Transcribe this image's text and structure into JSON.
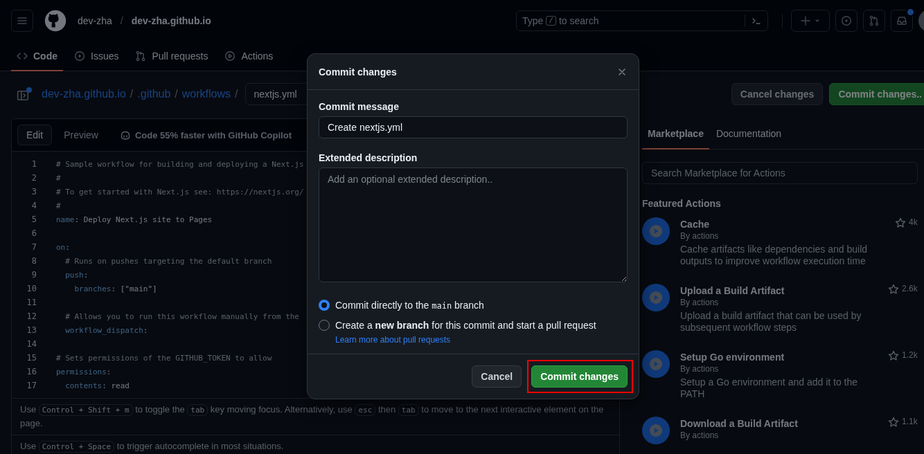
{
  "header": {
    "owner": "dev-zha",
    "separator": "/",
    "repo": "dev-zha.github.io",
    "search": {
      "before": "Type",
      "key": "/",
      "after": "to search"
    },
    "inbox_unread": true
  },
  "repo_tabs": [
    {
      "label": "Code",
      "selected": true
    },
    {
      "label": "Issues",
      "selected": false
    },
    {
      "label": "Pull requests",
      "selected": false
    },
    {
      "label": "Actions",
      "selected": false
    }
  ],
  "breadcrumb": {
    "path": [
      {
        "kind": "link",
        "text": "dev-zha.github.io"
      },
      {
        "kind": "separator",
        "text": "/"
      },
      {
        "kind": "link",
        "text": ".github"
      },
      {
        "kind": "separator",
        "text": "/"
      },
      {
        "kind": "link",
        "text": "workflows"
      },
      {
        "kind": "separator",
        "text": "/"
      }
    ],
    "filename": "nextjs.yml",
    "buttons": [
      {
        "label": "Cancel changes",
        "kind": "secondary"
      },
      {
        "label": "Commit changes..",
        "kind": "primary"
      }
    ]
  },
  "editor": {
    "tabs": [
      {
        "label": "Edit",
        "selected": true
      },
      {
        "label": "Preview",
        "selected": false
      }
    ],
    "copilot_hint": "Code 55% faster with GitHub Copilot",
    "lines": [
      {
        "number": "1",
        "tokens": [
          {
            "kind": "comment",
            "text": "# Sample workflow for building and deploying a Next.js"
          }
        ]
      },
      {
        "number": "2",
        "tokens": [
          {
            "kind": "comment",
            "text": "#"
          }
        ]
      },
      {
        "number": "3",
        "tokens": [
          {
            "kind": "comment",
            "text": "# To get started with Next.js see: https://nextjs.org/"
          }
        ]
      },
      {
        "number": "4",
        "tokens": [
          {
            "kind": "comment",
            "text": "#"
          }
        ]
      },
      {
        "number": "5",
        "tokens": [
          {
            "kind": "key",
            "text": "name"
          },
          {
            "kind": "plain",
            "text": ": Deploy Next.js site to Pages"
          }
        ]
      },
      {
        "number": "6"
      },
      {
        "number": "7",
        "tokens": [
          {
            "kind": "key",
            "text": "on"
          },
          {
            "kind": "plain",
            "text": ":"
          }
        ]
      },
      {
        "number": "8",
        "tokens": [
          {
            "kind": "comment",
            "text": "  # Runs on pushes targeting the default branch"
          }
        ]
      },
      {
        "number": "9",
        "tokens": [
          {
            "kind": "key",
            "text": "  push"
          },
          {
            "kind": "plain",
            "text": ":"
          }
        ]
      },
      {
        "number": "10",
        "tokens": [
          {
            "kind": "key",
            "text": "    branches"
          },
          {
            "kind": "plain",
            "text": ": [\"main\"]"
          }
        ]
      },
      {
        "number": "11"
      },
      {
        "number": "12",
        "tokens": [
          {
            "kind": "comment",
            "text": "  # Allows you to run this workflow manually from the"
          }
        ]
      },
      {
        "number": "13",
        "tokens": [
          {
            "kind": "key",
            "text": "  workflow_dispatch"
          },
          {
            "kind": "plain",
            "text": ":"
          }
        ]
      },
      {
        "number": "14"
      },
      {
        "number": "15",
        "tokens": [
          {
            "kind": "comment",
            "text": "# Sets permissions of the GITHUB_TOKEN to allow"
          }
        ]
      },
      {
        "number": "16",
        "tokens": [
          {
            "kind": "key",
            "text": "permissions"
          },
          {
            "kind": "plain",
            "text": ":"
          }
        ]
      },
      {
        "number": "17",
        "tokens": [
          {
            "kind": "key",
            "text": "  contents"
          },
          {
            "kind": "plain",
            "text": ": read"
          }
        ]
      }
    ],
    "help": [
      {
        "parts": [
          {
            "kind": "text",
            "text": "Use "
          },
          {
            "kind": "key",
            "text": "Control + Shift + m"
          },
          {
            "kind": "text",
            "text": " to toggle the "
          },
          {
            "kind": "key",
            "text": "tab"
          },
          {
            "kind": "text",
            "text": " key moving focus. Alternatively, use "
          },
          {
            "kind": "key",
            "text": "esc"
          },
          {
            "kind": "text",
            "text": " then "
          },
          {
            "kind": "key",
            "text": "tab"
          },
          {
            "kind": "text",
            "text": " to move to the next interactive element on the page."
          }
        ]
      },
      {
        "parts": [
          {
            "kind": "text",
            "text": "Use "
          },
          {
            "kind": "key",
            "text": "Control + Space"
          },
          {
            "kind": "text",
            "text": " to trigger autocomplete in most situations."
          }
        ]
      }
    ]
  },
  "marketplace": {
    "tabs": [
      {
        "label": "Marketplace",
        "selected": true
      },
      {
        "label": "Documentation",
        "selected": false
      }
    ],
    "search_placeholder": "Search Marketplace for Actions",
    "heading": "Featured Actions",
    "items": [
      {
        "title": "Cache",
        "author": "By actions",
        "description": "Cache artifacts like dependencies and build outputs to improve workflow execution time",
        "star_count": "4k"
      },
      {
        "title": "Upload a Build Artifact",
        "author": "By actions",
        "description": "Upload a build artifact that can be used by subsequent workflow steps",
        "star_count": "2.6k"
      },
      {
        "title": "Setup Go environment",
        "author": "By actions",
        "description": "Setup a Go environment and add it to the PATH",
        "star_count": "1.2k"
      },
      {
        "title": "Download a Build Artifact",
        "author": "By actions",
        "star_count": "1.1k"
      }
    ]
  },
  "dialog": {
    "title": "Commit changes",
    "message_label": "Commit message",
    "message_value": "Create nextjs.yml",
    "description_label": "Extended description",
    "description_placeholder": "Add an optional extended description..",
    "options": [
      {
        "selected": true,
        "parts": [
          {
            "kind": "text",
            "text": "Commit directly to the "
          },
          {
            "kind": "code",
            "text": "main"
          },
          {
            "kind": "text",
            "text": " branch"
          }
        ]
      },
      {
        "selected": false,
        "parts": [
          {
            "kind": "text",
            "text": "Create a "
          },
          {
            "kind": "bold",
            "text": "new branch"
          },
          {
            "kind": "text",
            "text": " for this commit and start a pull request"
          }
        ]
      }
    ],
    "learn_more": "Learn more about pull requests",
    "buttons": [
      {
        "label": "Cancel",
        "kind": "secondary",
        "highlighted": false
      },
      {
        "label": "Commit changes",
        "kind": "primary",
        "highlighted": true
      }
    ]
  }
}
